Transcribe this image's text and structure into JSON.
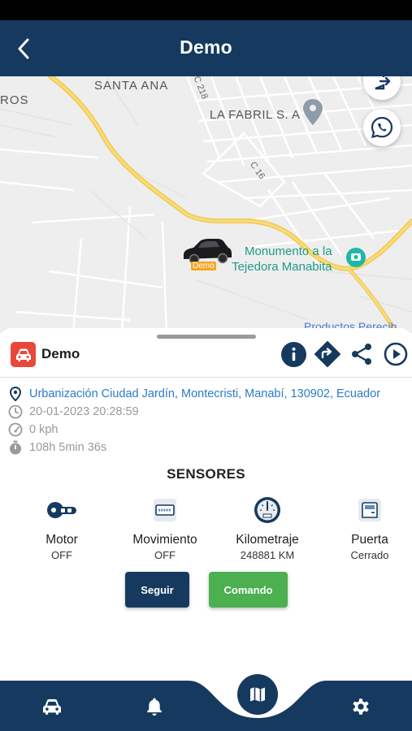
{
  "header": {
    "title": "Demo"
  },
  "map": {
    "labels": {
      "ros": "ROS",
      "santa_ana": "SANTA ANA",
      "la_fabril": "LA FABRIL S. A",
      "c218": "C 218",
      "c16": "C 16",
      "monumento_line1": "Monumento a la",
      "monumento_line2": "Tejedora Manabita",
      "productos": "Productos Perecib"
    },
    "car_tag": "Demo"
  },
  "device": {
    "name": "Demo"
  },
  "info": {
    "address": "Urbanización Ciudad Jardín, Montecristi, Manabí, 130902, Ecuador",
    "datetime": "20-01-2023 20:28:59",
    "speed": "0 kph",
    "duration": "108h 5min 36s"
  },
  "sensors": {
    "title": "SENSORES",
    "items": [
      {
        "name": "Motor",
        "value": "OFF"
      },
      {
        "name": "Movimiento",
        "value": "OFF"
      },
      {
        "name": "Kilometraje",
        "value": "248881 KM"
      },
      {
        "name": "Puerta",
        "value": "Cerrado"
      }
    ]
  },
  "buttons": {
    "follow": "Seguir",
    "command": "Comando"
  },
  "colors": {
    "primary": "#163a5f",
    "success": "#4caf50",
    "accent": "#e8483b",
    "link": "#2a7cc7"
  }
}
